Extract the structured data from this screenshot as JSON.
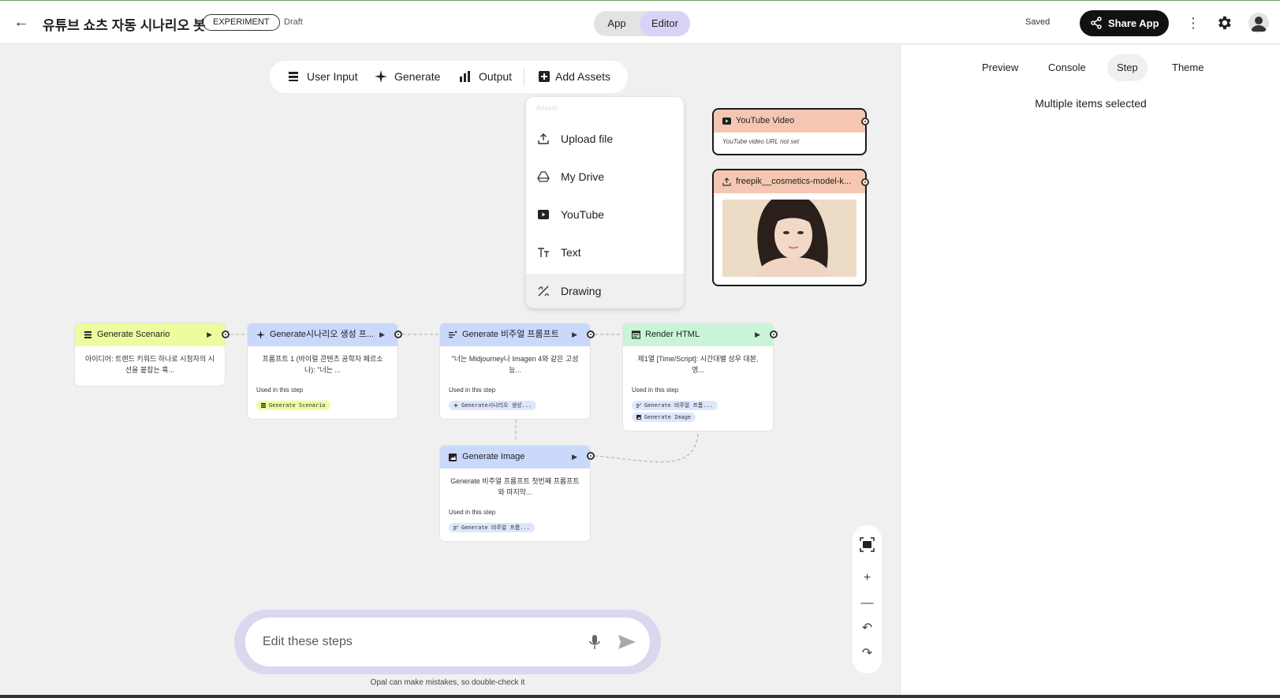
{
  "header": {
    "title": "유튜브 쇼츠 자동 시나리오 봇",
    "badge": "EXPERIMENT",
    "status": "Draft",
    "mode_app": "App",
    "mode_editor": "Editor",
    "saved": "Saved",
    "share_label": "Share App"
  },
  "toolbar": {
    "user_input": "User Input",
    "generate": "Generate",
    "output": "Output",
    "add_assets": "Add Assets"
  },
  "assets_menu": {
    "heading": "Assets",
    "items": [
      "Upload file",
      "My Drive",
      "YouTube",
      "Text",
      "Drawing"
    ]
  },
  "assets": {
    "youtube": {
      "title": "YouTube Video",
      "subtitle": "YouTube video URL not set"
    },
    "image": {
      "title": "freepik__cosmetics-model-k..."
    }
  },
  "nodes": {
    "scenario": {
      "title": "Generate Scenario",
      "body": "아이디어: 트렌드 키워드 하나로 시청자의 시선을 붙잡는 혹..."
    },
    "prompt": {
      "title": "Generate시나리오 생성 프...",
      "body": "프롬프트 1 (바이럴 콘텐츠 공학자 페르소나): \"너는 ...",
      "used": "Used in this step",
      "chips": [
        "Generate Scenario"
      ]
    },
    "visual": {
      "title": "Generate 비주얼 프롬프트",
      "body": "\"너는 Midjourney나 Imagen 4와 같은 고성능...",
      "used": "Used in this step",
      "chips": [
        "Generate시나리오 생성..."
      ]
    },
    "render": {
      "title": "Render HTML",
      "body": "제1열 [Time/Script]: 시간대별 성우 대본, 영...",
      "used": "Used in this step",
      "chips": [
        "Generate 비주얼 프롬...",
        "Generate Image"
      ]
    },
    "image": {
      "title": "Generate Image",
      "body": "Generate 비주얼 프롬프트 첫번째 프롬프트와 마지막...",
      "used": "Used in this step",
      "chips": [
        "Generate 비주얼 프롬..."
      ]
    }
  },
  "chat": {
    "placeholder": "Edit these steps",
    "disclaimer": "Opal can make mistakes, so double-check it"
  },
  "right_panel": {
    "tabs": [
      "Preview",
      "Console",
      "Step",
      "Theme"
    ],
    "active_tab": "Step",
    "message": "Multiple items selected"
  },
  "colors": {
    "scenario": "#eefc9f",
    "generate": "#c9d8fb",
    "render": "#c9f4d9",
    "asset": "#f5c6b1",
    "editor_active": "#d9d3f7"
  },
  "icons": {
    "back": "arrow-left-icon",
    "share": "share-icon",
    "more": "kebab-icon",
    "settings": "gear-icon",
    "account": "avatar-icon"
  }
}
